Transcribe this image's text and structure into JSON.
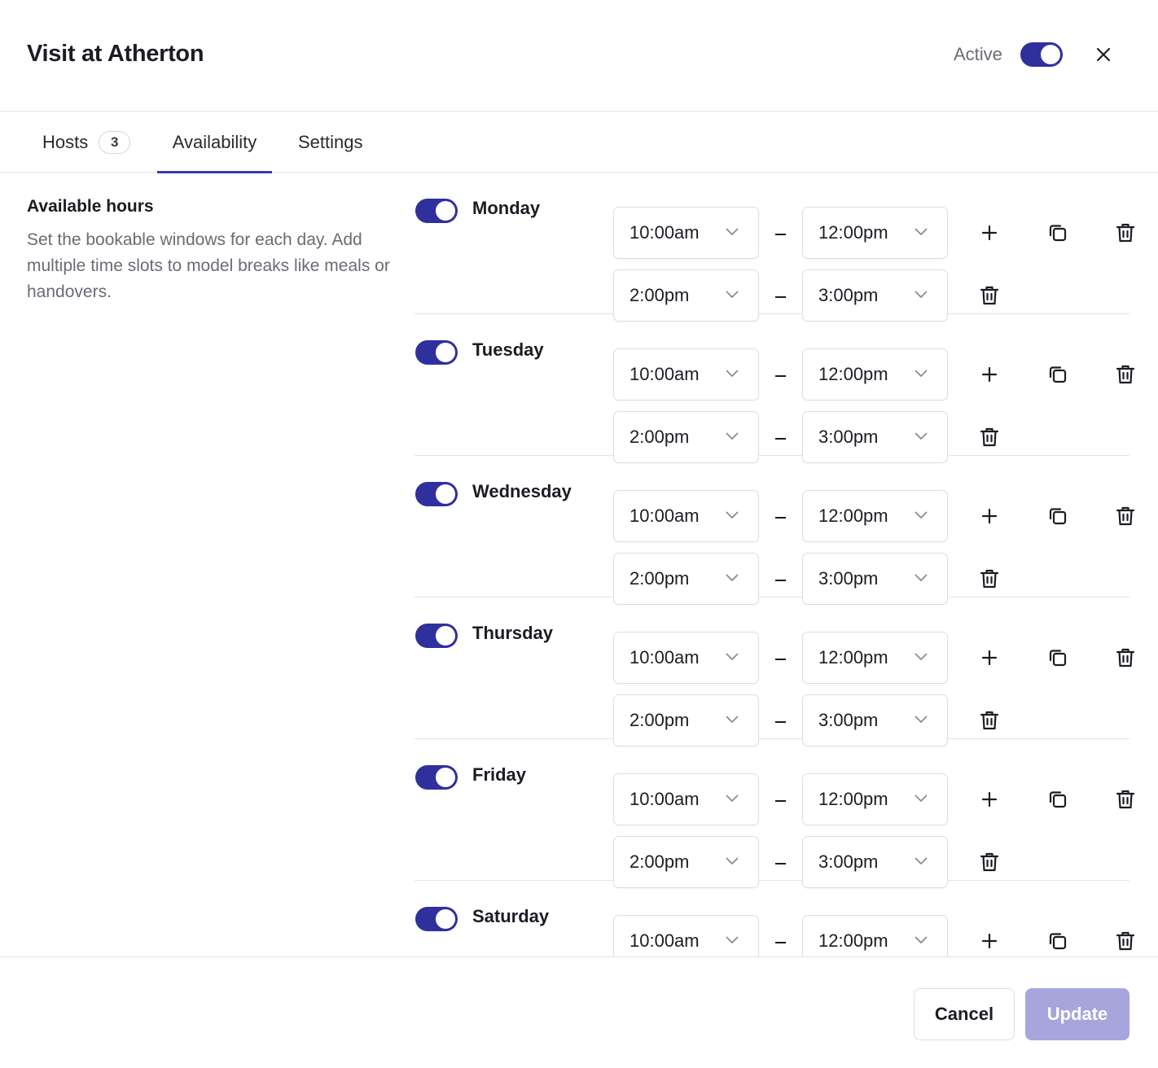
{
  "header": {
    "title": "Visit at Atherton",
    "active_label": "Active",
    "active_on": true
  },
  "tabs": [
    {
      "label": "Hosts",
      "badge": "3"
    },
    {
      "label": "Availability",
      "selected": true
    },
    {
      "label": "Settings"
    }
  ],
  "sidebar": {
    "title": "Available hours",
    "description": "Set the bookable windows for each day. Add multiple time slots to model breaks like meals or handovers."
  },
  "days": [
    {
      "name": "Monday",
      "enabled": true,
      "slots": [
        {
          "start": "10:00am",
          "end": "12:00pm"
        },
        {
          "start": "2:00pm",
          "end": "3:00pm"
        }
      ]
    },
    {
      "name": "Tuesday",
      "enabled": true,
      "slots": [
        {
          "start": "10:00am",
          "end": "12:00pm"
        },
        {
          "start": "2:00pm",
          "end": "3:00pm"
        }
      ]
    },
    {
      "name": "Wednesday",
      "enabled": true,
      "slots": [
        {
          "start": "10:00am",
          "end": "12:00pm"
        },
        {
          "start": "2:00pm",
          "end": "3:00pm"
        }
      ]
    },
    {
      "name": "Thursday",
      "enabled": true,
      "slots": [
        {
          "start": "10:00am",
          "end": "12:00pm"
        },
        {
          "start": "2:00pm",
          "end": "3:00pm"
        }
      ]
    },
    {
      "name": "Friday",
      "enabled": true,
      "slots": [
        {
          "start": "10:00am",
          "end": "12:00pm"
        },
        {
          "start": "2:00pm",
          "end": "3:00pm"
        }
      ]
    },
    {
      "name": "Saturday",
      "enabled": true,
      "slots": [
        {
          "start": "10:00am",
          "end": "12:00pm"
        }
      ]
    }
  ],
  "icons": {
    "close": "close-icon",
    "chevron": "chevron-down-icon",
    "add": "plus-icon",
    "copy": "copy-icon",
    "delete": "trash-icon"
  },
  "footer": {
    "cancel_label": "Cancel",
    "update_label": "Update"
  },
  "colors": {
    "accent": "#2f2f9e",
    "tab_underline": "#3b3bb0",
    "update_disabled": "#a6a5dc"
  }
}
